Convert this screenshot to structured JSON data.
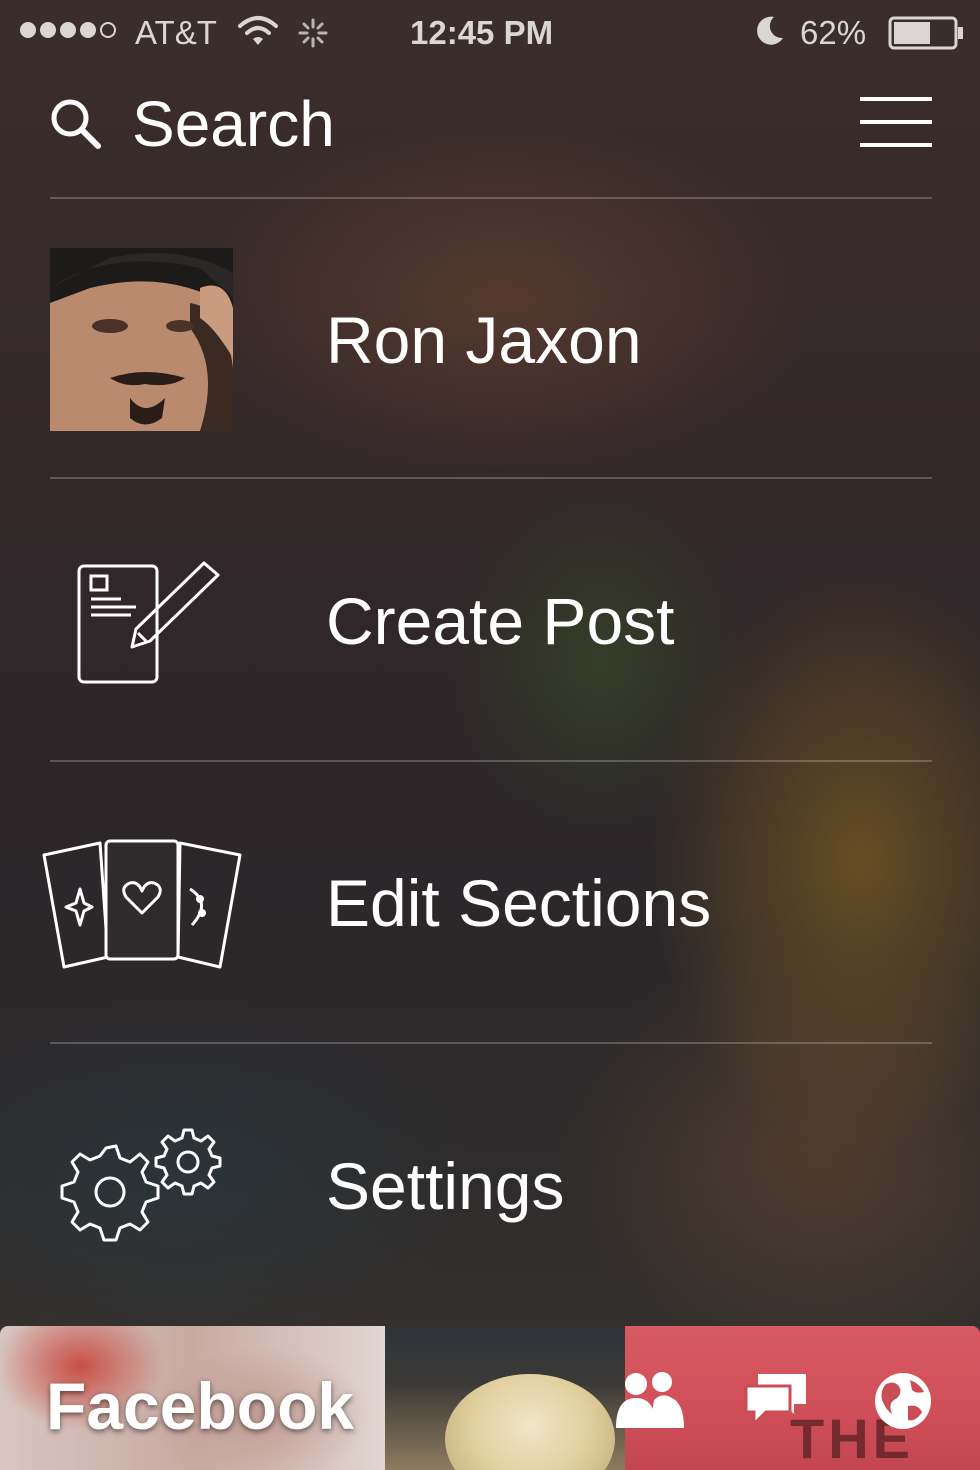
{
  "status_bar": {
    "carrier": "AT&T",
    "time": "12:45 PM",
    "battery": "62%",
    "signal_bars": 4,
    "signal_total": 5,
    "battery_level": 0.62,
    "icons": [
      "wifi-icon",
      "activity-spinner-icon",
      "moon-icon",
      "battery-icon"
    ]
  },
  "header": {
    "search_label": "Search",
    "icons": [
      "search-icon",
      "hamburger-menu-icon"
    ]
  },
  "menu": {
    "items": [
      {
        "label": "Ron Jaxon",
        "icon": "profile-avatar"
      },
      {
        "label": "Create Post",
        "icon": "compose-post-icon"
      },
      {
        "label": "Edit Sections",
        "icon": "section-cards-icon"
      },
      {
        "label": "Settings",
        "icon": "gears-icon"
      }
    ]
  },
  "bottom_card": {
    "title": "Facebook",
    "sign_text": "THE HU",
    "icons": [
      "friends-icon",
      "messages-icon",
      "globe-icon"
    ]
  },
  "colors": {
    "text": "#ffffff",
    "status_text": "#d9d6d3",
    "divider": "rgba(255,255,255,0.22)"
  }
}
